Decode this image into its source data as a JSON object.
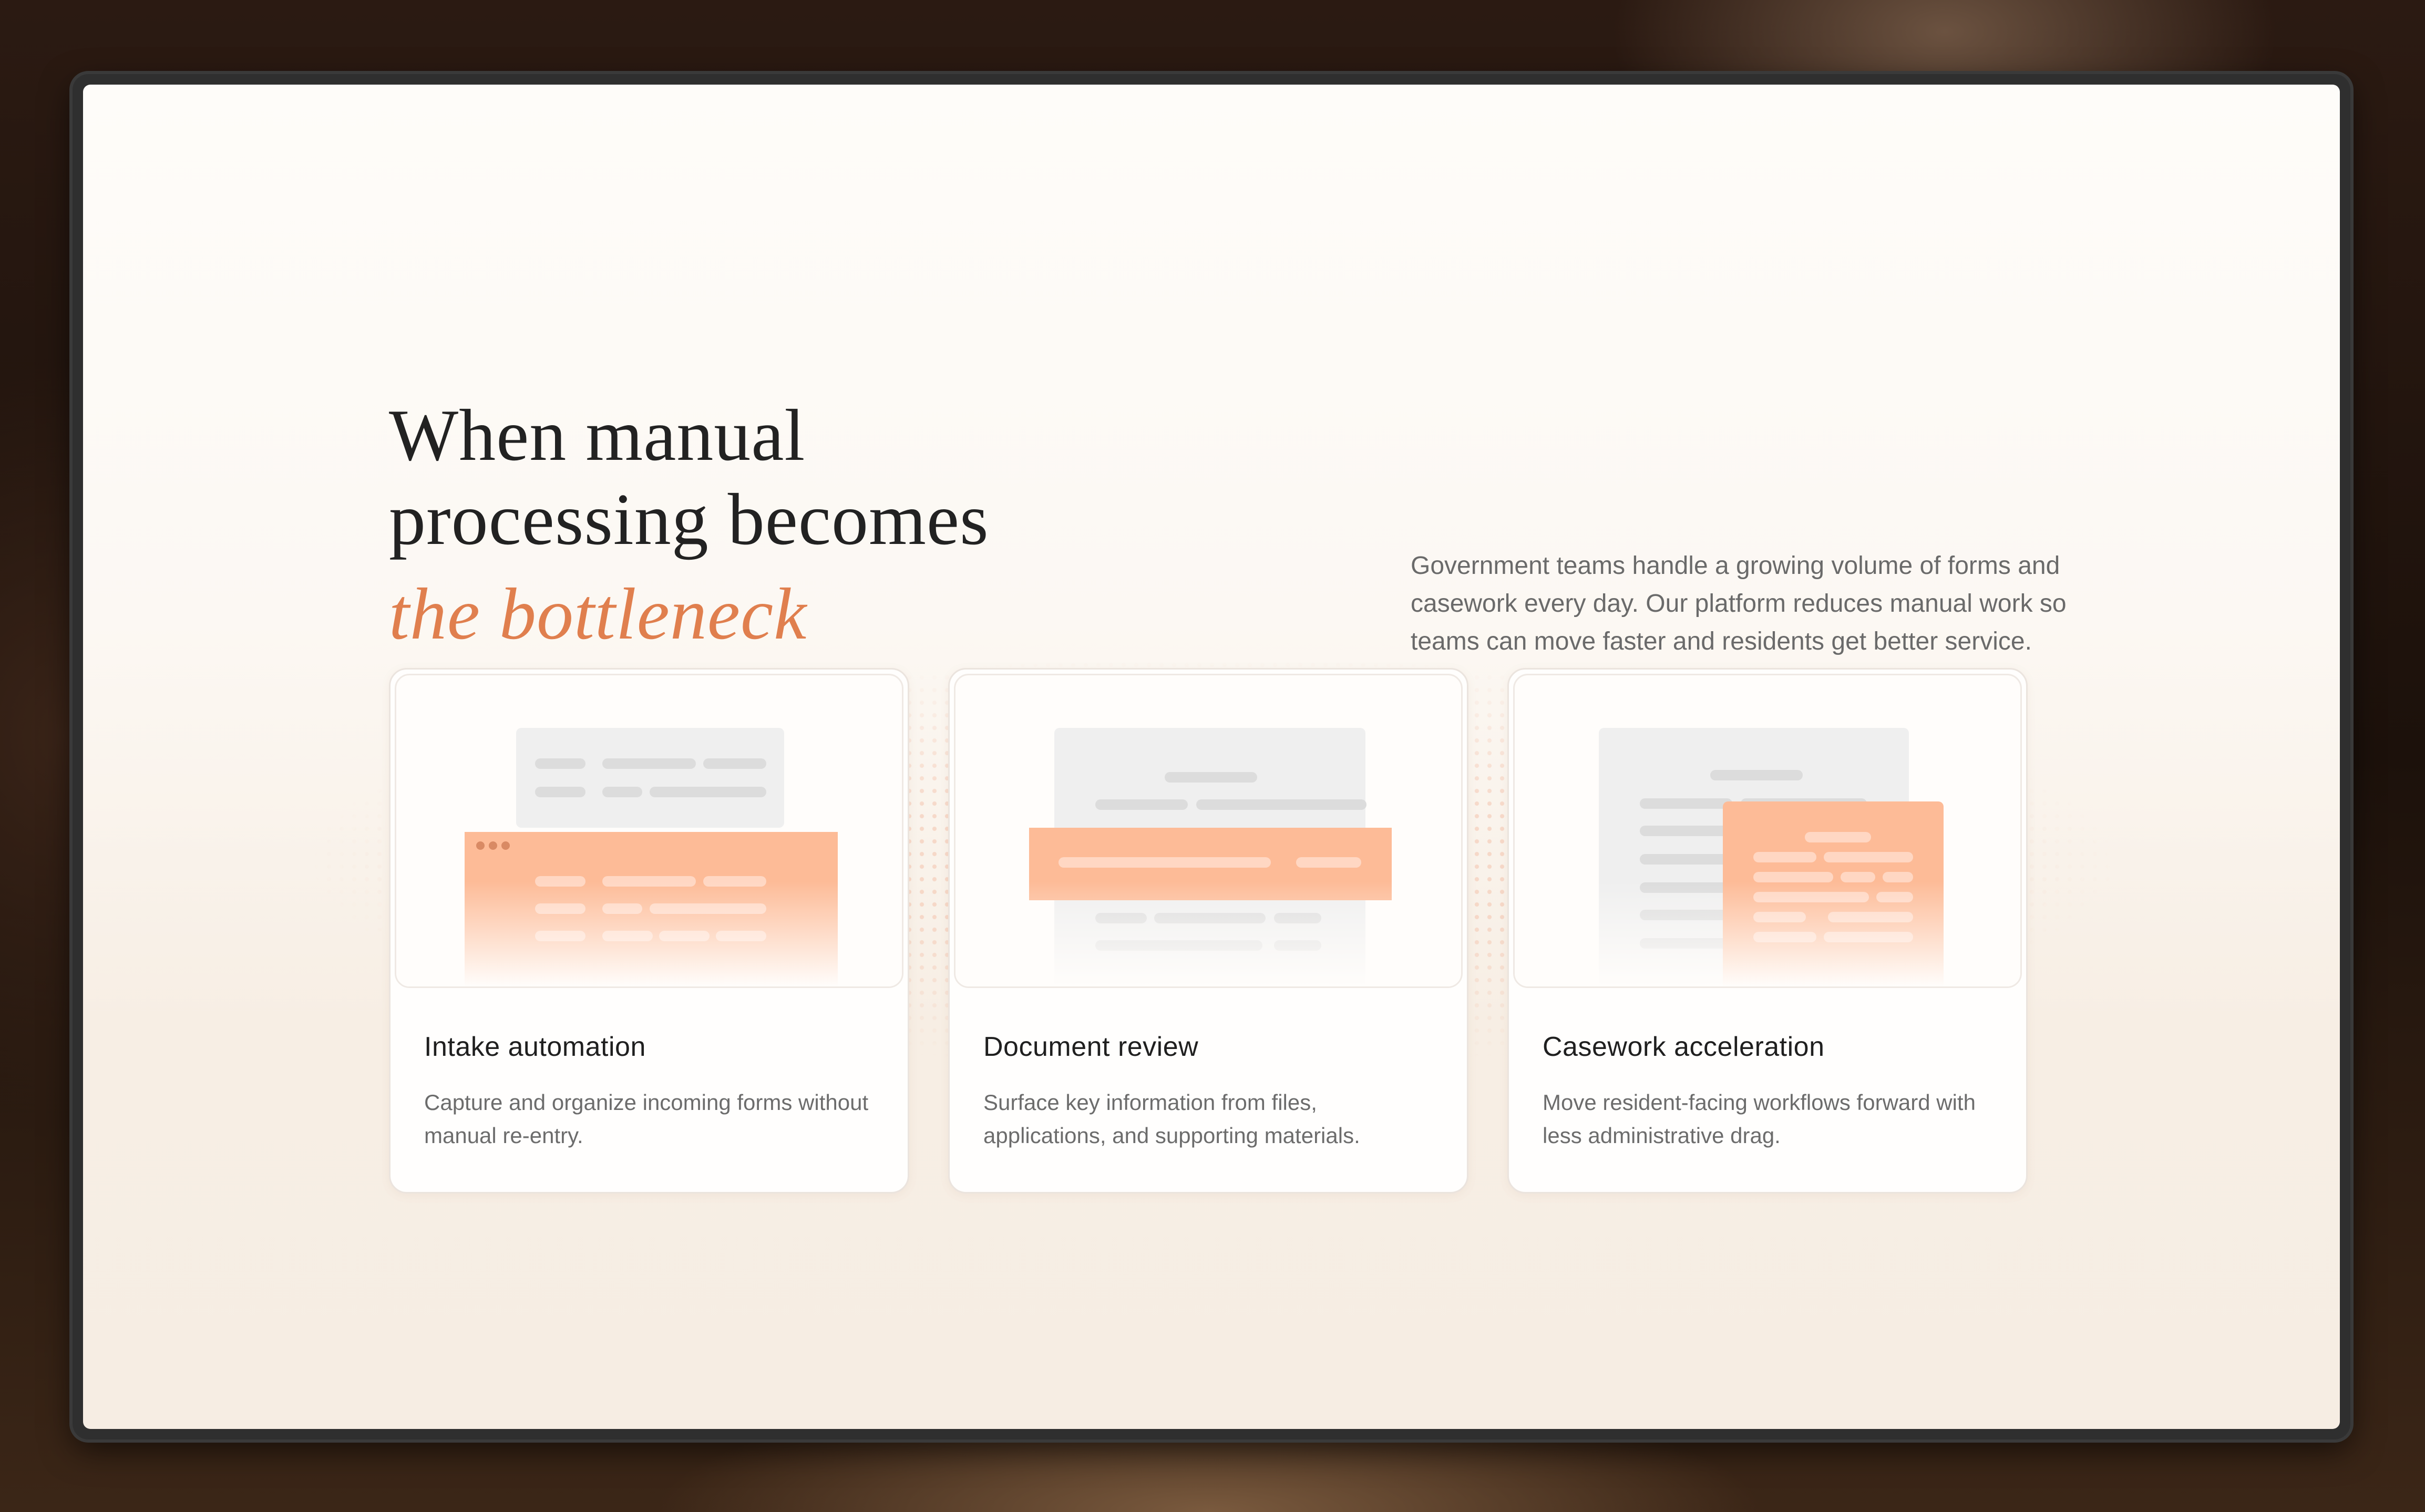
{
  "hero": {
    "headline_line1": "When manual",
    "headline_line2": "processing becomes",
    "headline_accent": "the bottleneck",
    "lede": "Government teams handle a growing volume of forms and casework every day. Our platform reduces manual work so teams can move faster and residents get better service."
  },
  "cards": [
    {
      "title": "Intake automation",
      "description": "Capture and organize incoming forms without manual re-entry."
    },
    {
      "title": "Document review",
      "description": "Surface key information from files, applications, and supporting materials."
    },
    {
      "title": "Casework acceleration",
      "description": "Move resident-facing workflows forward with less administrative drag."
    }
  ],
  "colors": {
    "accent": "#e07f4e",
    "peach": "#fdbb97",
    "page_bg": "#fcf8f3",
    "text_dark": "#222222",
    "text_muted": "#6a6a6a"
  }
}
